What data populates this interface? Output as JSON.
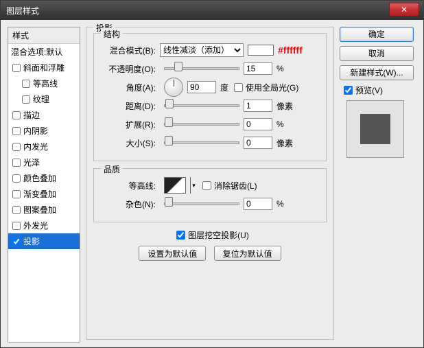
{
  "window": {
    "title": "图层样式"
  },
  "buttons": {
    "ok": "确定",
    "cancel": "取消",
    "new_style": "新建样式(W)...",
    "close_x": "✕",
    "set_default": "设置为默认值",
    "reset_default": "复位为默认值"
  },
  "left": {
    "header": "样式",
    "blend": "混合选项:默认",
    "items": [
      {
        "label": "斜面和浮雕",
        "checked": false,
        "indent": false
      },
      {
        "label": "等高线",
        "checked": false,
        "indent": true
      },
      {
        "label": "纹理",
        "checked": false,
        "indent": true
      },
      {
        "label": "描边",
        "checked": false,
        "indent": false
      },
      {
        "label": "内阴影",
        "checked": false,
        "indent": false
      },
      {
        "label": "内发光",
        "checked": false,
        "indent": false
      },
      {
        "label": "光泽",
        "checked": false,
        "indent": false
      },
      {
        "label": "颜色叠加",
        "checked": false,
        "indent": false
      },
      {
        "label": "渐变叠加",
        "checked": false,
        "indent": false
      },
      {
        "label": "图案叠加",
        "checked": false,
        "indent": false
      },
      {
        "label": "外发光",
        "checked": false,
        "indent": false
      },
      {
        "label": "投影",
        "checked": true,
        "indent": false,
        "selected": true
      }
    ]
  },
  "preview": {
    "label": "预览(V)",
    "checked": true
  },
  "center": {
    "heading": "投影",
    "structure": {
      "legend": "结构",
      "blend_mode_label": "混合模式(B):",
      "blend_mode_value": "线性减淡（添加）",
      "color_hex": "#ffffff",
      "opacity_label": "不透明度(O):",
      "opacity_value": "15",
      "opacity_unit": "%",
      "angle_label": "角度(A):",
      "angle_value": "90",
      "angle_unit": "度",
      "global_light_label": "使用全局光(G)",
      "global_light_checked": false,
      "distance_label": "距离(D):",
      "distance_value": "1",
      "distance_unit": "像素",
      "spread_label": "扩展(R):",
      "spread_value": "0",
      "spread_unit": "%",
      "size_label": "大小(S):",
      "size_value": "0",
      "size_unit": "像素"
    },
    "quality": {
      "legend": "品质",
      "contour_label": "等高线:",
      "antialias_label": "消除锯齿(L)",
      "antialias_checked": false,
      "noise_label": "杂色(N):",
      "noise_value": "0",
      "noise_unit": "%"
    },
    "knockout": {
      "label": "图层挖空投影(U)",
      "checked": true
    }
  }
}
